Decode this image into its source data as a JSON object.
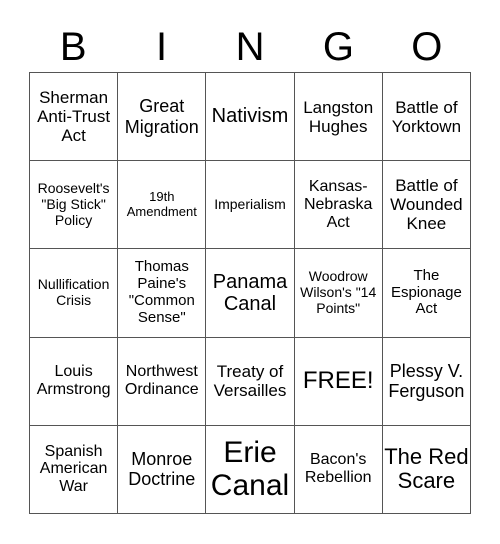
{
  "header": [
    "B",
    "I",
    "N",
    "G",
    "O"
  ],
  "cells": [
    [
      "Sherman Anti-Trust Act",
      "Great Migration",
      "Nativism",
      "Langston Hughes",
      "Battle of Yorktown"
    ],
    [
      "Roosevelt's \"Big Stick\" Policy",
      "19th Amendment",
      "Imperialism",
      "Kansas-Nebraska Act",
      "Battle of Wounded Knee"
    ],
    [
      "Nullification Crisis",
      "Thomas Paine's \"Common Sense\"",
      "Panama Canal",
      "Woodrow Wilson's \"14 Points\"",
      "The Espionage Act"
    ],
    [
      "Louis Armstrong",
      "Northwest Ordinance",
      "Treaty of Versailles",
      "FREE!",
      "Plessy V. Ferguson"
    ],
    [
      "Spanish American War",
      "Monroe Doctrine",
      "Erie Canal",
      "Bacon's Rebellion",
      "The Red Scare"
    ]
  ]
}
